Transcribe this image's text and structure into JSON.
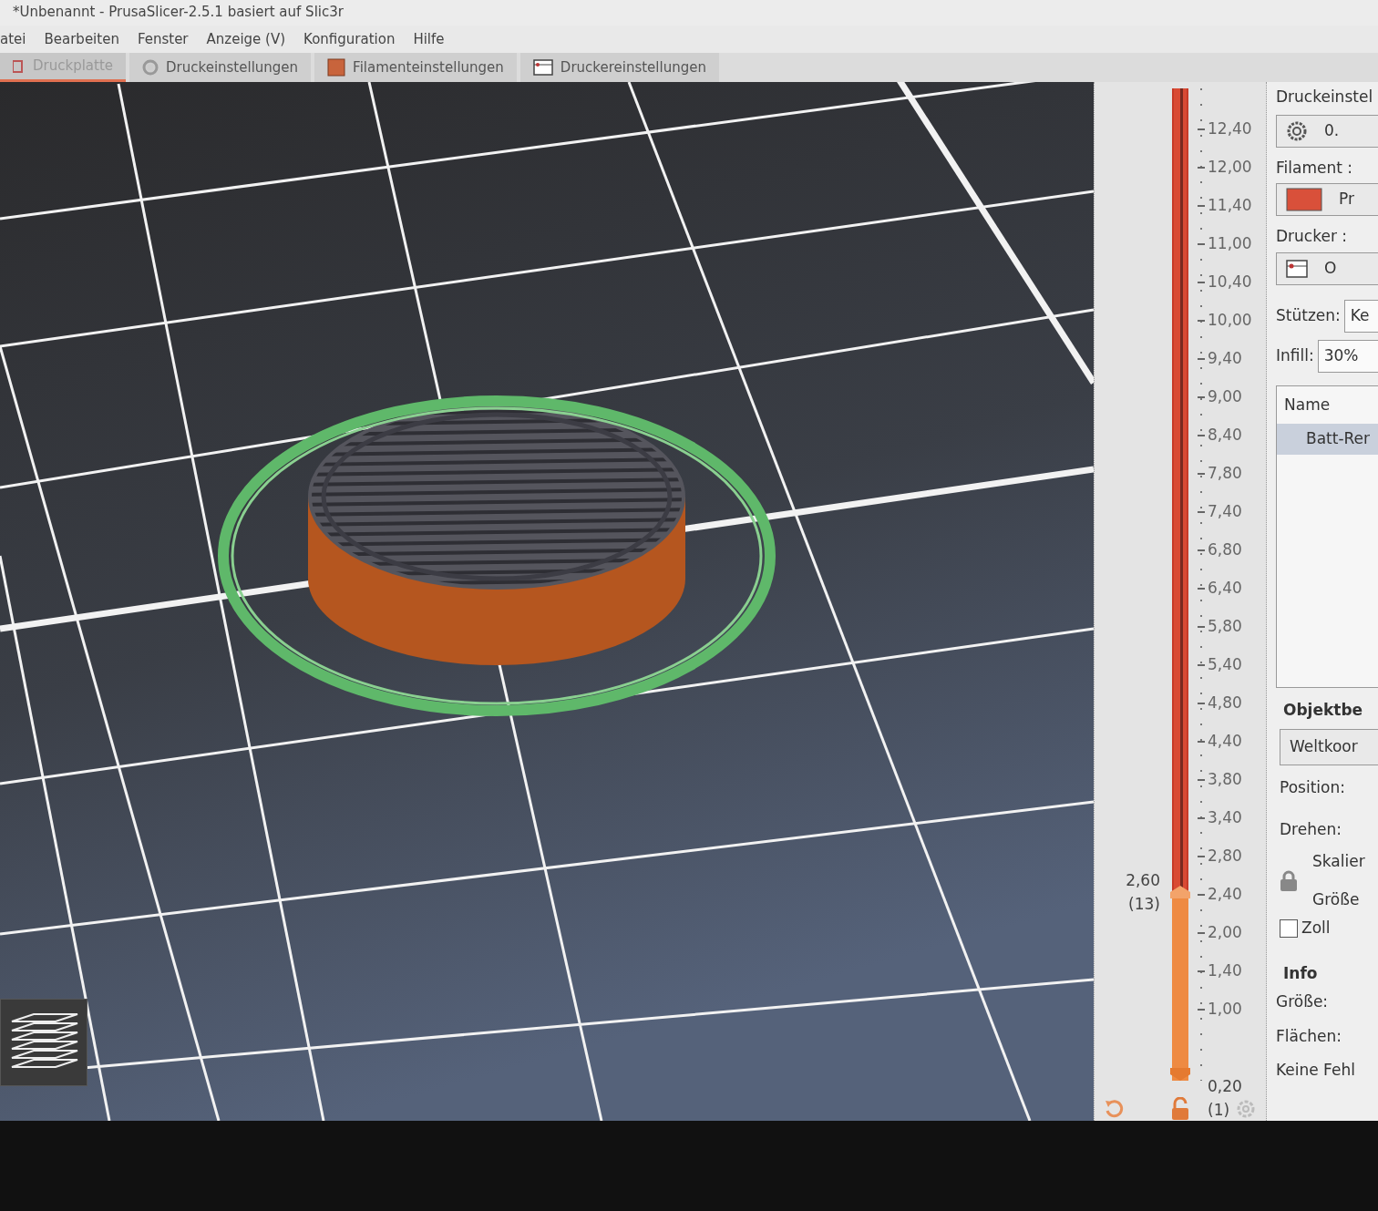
{
  "window": {
    "title": "*Unbenannt - PrusaSlicer-2.5.1 basiert auf Slic3r"
  },
  "menu": [
    "atei",
    "Bearbeiten",
    "Fenster",
    "Anzeige (V)",
    "Konfiguration",
    "Hilfe"
  ],
  "tabs": [
    {
      "label": "Druckplatte",
      "selected": true
    },
    {
      "label": "Druckeinstellungen",
      "selected": false
    },
    {
      "label": "Filamenteinstellungen",
      "selected": false
    },
    {
      "label": "Druckereinstellungen",
      "selected": false
    }
  ],
  "layer_slider": {
    "ticks": [
      "12,40",
      "12,00",
      "11,40",
      "11,00",
      "10,40",
      "10,00",
      "9,40",
      "9,00",
      "8,40",
      "7,80",
      "7,40",
      "6,80",
      "6,40",
      "5,80",
      "5,40",
      "4,80",
      "4,40",
      "3,80",
      "3,40",
      "2,80",
      "2,40",
      "2,00",
      "1,40",
      "1,00"
    ],
    "upper": {
      "value": "2,60",
      "layer": "(13)",
      "level": 0.19
    },
    "lower": {
      "value": "0,20",
      "layer": "(1)",
      "level": 0
    }
  },
  "sidebar": {
    "print_settings_label": "Druckeinstel",
    "print_preset": "0.",
    "filament_label": "Filament :",
    "filament_preset": "Pr",
    "printer_label": "Drucker :",
    "printer_preset": "O",
    "supports_label": "Stützen:",
    "supports_value": "Ke",
    "infill_label": "Infill:",
    "infill_value": "30%",
    "object_list": {
      "column": "Name",
      "rows": [
        {
          "name": "Batt-Rer",
          "selected": true
        }
      ]
    },
    "object_manipulation": {
      "title": "Objektbe",
      "coordinates": "Weltkoor",
      "position_label": "Position:",
      "rotate_label": "Drehen:",
      "scale_label": "Skalier",
      "size_label": "Größe",
      "inches": {
        "label": "Zoll",
        "checked": false
      }
    },
    "info": {
      "title": "Info",
      "size_label": "Größe:",
      "facets_label": "Flächen:",
      "errors": "Keine Fehl"
    }
  }
}
